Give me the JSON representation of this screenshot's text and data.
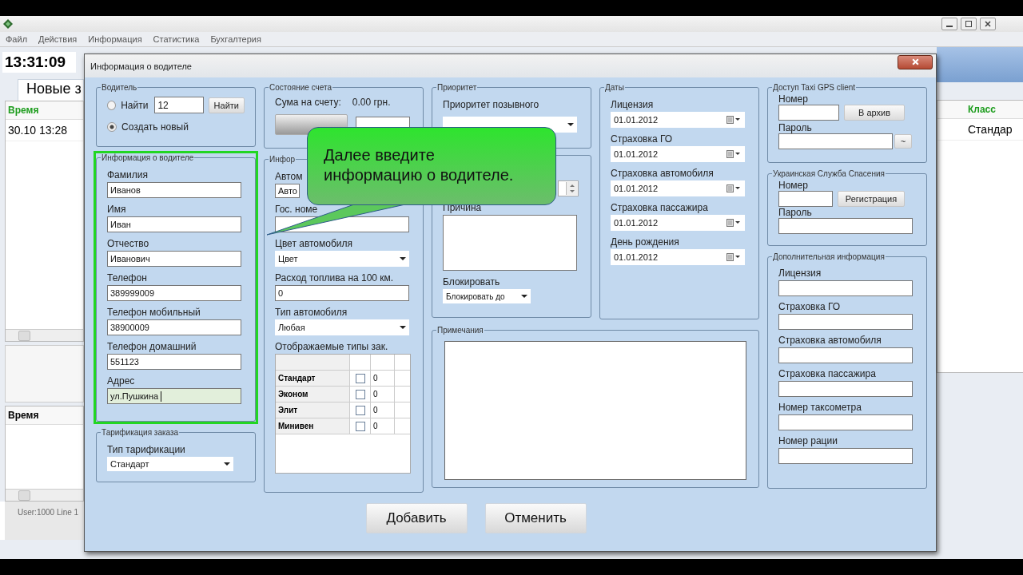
{
  "app": {
    "menu": [
      "Файл",
      "Действия",
      "Информация",
      "Статистика",
      "Бухгалтерия"
    ],
    "clock": "13:31:09",
    "tab": "Новые з",
    "left_table": {
      "header": "Время",
      "rows": [
        "30.10 13:28"
      ]
    },
    "lower_table": {
      "header": "Время"
    },
    "right_table": {
      "header": "Класс",
      "rows": [
        "Стандар"
      ]
    },
    "status": "User:1000 Line 1"
  },
  "dialog": {
    "title": "Информация о водителе",
    "driver": {
      "title": "Водитель",
      "options": [
        {
          "label": "Найти",
          "selected": false
        },
        {
          "label": "Создать новый",
          "selected": true
        }
      ],
      "search_value": "12",
      "find_button": "Найти"
    },
    "driver_info": {
      "title": "Информация о водителе",
      "highlighted": true,
      "fields": [
        {
          "label": "Фамилия",
          "value": "Иванов",
          "focused": false
        },
        {
          "label": "Имя",
          "value": "Иван",
          "focused": false
        },
        {
          "label": "Отчество",
          "value": "Иванович",
          "focused": false
        },
        {
          "label": "Телефон",
          "value": "389999009",
          "focused": false
        },
        {
          "label": "Телефон мобильный",
          "value": "38900009",
          "focused": false
        },
        {
          "label": "Телефон домашний",
          "value": "551123",
          "focused": false
        },
        {
          "label": "Адрес",
          "value": "ул.Пушкина",
          "focused": true
        }
      ]
    },
    "tariff": {
      "title": "Тарификация заказа",
      "label": "Тип тарификации",
      "value": "Стандарт"
    },
    "account": {
      "title": "Состояние счета",
      "balance_label": "Сума на счету:",
      "balance": "0.00 грн."
    },
    "car": {
      "title": "Инфор",
      "fields": [
        {
          "kind": "text",
          "label": "Автом",
          "value": "Авто"
        },
        {
          "kind": "text",
          "label": "Гос. номе"
        },
        {
          "kind": "dropdown",
          "label": "Цвет автомобиля",
          "value": "Цвет"
        },
        {
          "kind": "text",
          "label": "Расход топлива на 100 км.",
          "value": "0"
        },
        {
          "kind": "dropdown",
          "label": "Тип автомобиля",
          "value": "Любая"
        }
      ],
      "types_label": "Отображаемые типы зак.",
      "types": [
        {
          "name": "Стандарт",
          "checked": false,
          "count": "0"
        },
        {
          "name": "Эконом",
          "checked": false,
          "count": "0"
        },
        {
          "name": "Элит",
          "checked": false,
          "count": "0"
        },
        {
          "name": "Минивен",
          "checked": false,
          "count": "0"
        }
      ]
    },
    "priority": {
      "title": "Приоритет",
      "label": "Приоритет позывного"
    },
    "block": {
      "reason_label": "Причина",
      "block_label": "Блокировать",
      "block_value": "Блокировать до"
    },
    "notes": {
      "title": "Примечания"
    },
    "dates": {
      "title": "Даты",
      "fields": [
        {
          "label": "Лицензия",
          "value": "01.01.2012"
        },
        {
          "label": "Страховка ГО",
          "value": "01.01.2012"
        },
        {
          "label": "Страховка автомобиля",
          "value": "01.01.2012"
        },
        {
          "label": "Страховка пассажира",
          "value": "01.01.2012"
        },
        {
          "label": "День рождения",
          "value": "01.01.2012"
        }
      ]
    },
    "gps": {
      "title": "Доступ Taxi GPS client",
      "number_label": "Номер",
      "archive_button": "В архив",
      "password_label": "Пароль",
      "more_button": "~"
    },
    "rescue": {
      "title": "Украинская Служба Спасения",
      "number_label": "Номер",
      "register_button": "Регистрация",
      "password_label": "Пароль"
    },
    "extra": {
      "title": "Дополнительная информация",
      "fields": [
        "Лицензия",
        "Страховка ГО",
        "Страховка автомобиля",
        "Страховка пассажира",
        "Номер таксометра",
        "Номер рации"
      ]
    },
    "buttons": [
      "Добавить",
      "Отменить"
    ],
    "callout": "Далее введите информацию о водителе."
  }
}
